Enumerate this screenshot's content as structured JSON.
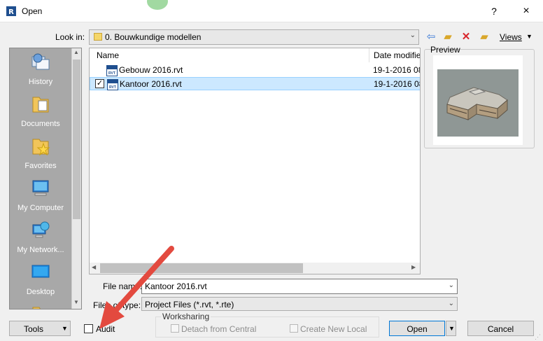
{
  "window": {
    "title": "Open",
    "help_label": "?",
    "close_label": "×"
  },
  "lookin": {
    "label": "Look in:",
    "value": "0. Bouwkundige modellen"
  },
  "toolbar": {
    "icons": [
      "back-icon",
      "up-folder-icon",
      "delete-icon",
      "new-folder-icon"
    ],
    "views_label": "Views"
  },
  "places": [
    {
      "label": "History",
      "icon": "history-icon"
    },
    {
      "label": "Documents",
      "icon": "documents-icon"
    },
    {
      "label": "Favorites",
      "icon": "favorites-icon"
    },
    {
      "label": "My Computer",
      "icon": "computer-icon"
    },
    {
      "label": "My Network...",
      "icon": "network-icon"
    },
    {
      "label": "Desktop",
      "icon": "desktop-icon"
    }
  ],
  "filelist": {
    "columns": [
      "Name",
      "Date modifie"
    ],
    "rows": [
      {
        "name": "Gebouw 2016.rvt",
        "date": "19-1-2016 08",
        "selected": false
      },
      {
        "name": "Kantoor 2016.rvt",
        "date": "19-1-2016 08",
        "selected": true
      }
    ],
    "file_icon_text": "RVT"
  },
  "preview": {
    "label": "Preview"
  },
  "filename": {
    "label": "File name:",
    "value": "Kantoor 2016.rvt"
  },
  "filetype": {
    "label": "Files of type:",
    "value": "Project Files  (*.rvt, *.rte)"
  },
  "bottom": {
    "tools_label": "Tools",
    "audit_label": "Audit",
    "worksharing_label": "Worksharing",
    "detach_label": "Detach from Central",
    "create_local_label": "Create New Local",
    "open_label": "Open",
    "cancel_label": "Cancel"
  },
  "colors": {
    "accent": "#0078d7",
    "selection": "#cce8ff",
    "annotation_arrow": "#e34a3f"
  }
}
